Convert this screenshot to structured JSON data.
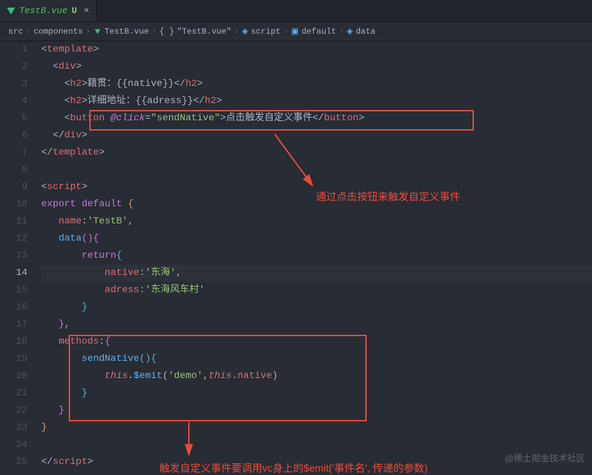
{
  "tab": {
    "filename": "TestB.vue",
    "status": "U"
  },
  "breadcrumb": {
    "parts": [
      "src",
      "components",
      "TestB.vue",
      "\"TestB.vue\"",
      "script",
      "default",
      "data"
    ]
  },
  "code": {
    "lines": [
      "<template>",
      "  <div>",
      "    <h2>籍贯：{{native}}</h2>",
      "    <h2>详细地址：{{adress}}</h2>",
      "    <button @click=\"sendNative\">点击触发自定义事件</button>",
      "  </div>",
      "</template>",
      "",
      "<script>",
      "export default {",
      "   name:'TestB',",
      "   data(){",
      "       return{",
      "           native:'东海',",
      "           adress:'东海风车村'",
      "       }",
      "   },",
      "   methods:{",
      "       sendNative(){",
      "           this.$emit('demo',this.native)",
      "       }",
      "   }",
      "}",
      "",
      "</script>"
    ]
  },
  "annotations": {
    "a1": "通过点击按钮来触发自定义事件",
    "a2": "触发自定义事件要调用vc身上的$emit('事件名', 传递的参数)"
  },
  "watermark": "@稀土掘金技术社区",
  "activeLineNum": 14
}
